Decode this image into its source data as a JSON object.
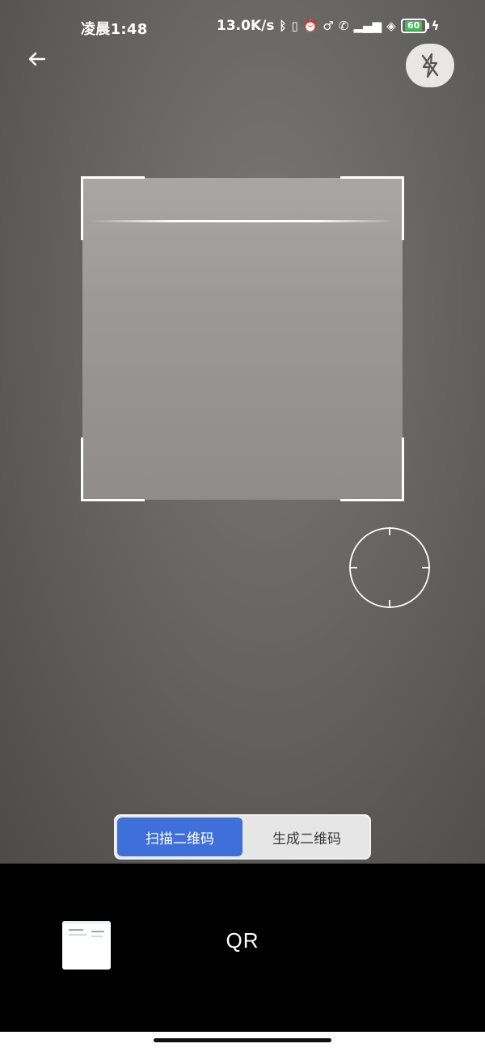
{
  "status_bar": {
    "time": "凌晨1:48",
    "net_speed": "13.0K/s",
    "battery": "60"
  },
  "header": {
    "back_icon": "arrow-left-icon",
    "flash_icon": "flash-off-icon"
  },
  "scanner": {
    "focus_icon": "focus-reticle-icon"
  },
  "mode_toggle": {
    "scan_label": "扫描二维码",
    "generate_label": "生成二维码",
    "active": "scan",
    "active_color": "#3f6fd8"
  },
  "bottom_bar": {
    "mode_label": "QR",
    "thumbnail_icon": "gallery-thumbnail"
  }
}
